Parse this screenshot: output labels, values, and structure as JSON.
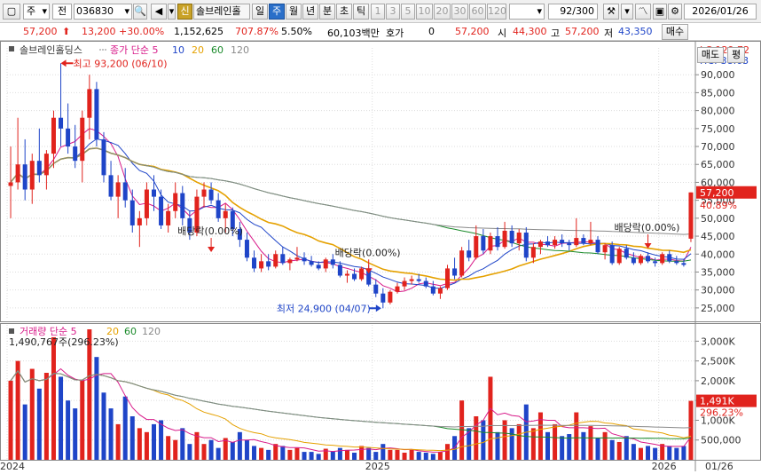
{
  "toolbar": {
    "period_select": "주",
    "market": "전",
    "code": "036830",
    "stock_name": "솔브레인홀",
    "tag": "신",
    "period_tabs": [
      "일",
      "주",
      "월",
      "년",
      "분",
      "초",
      "틱"
    ],
    "active_period": "주",
    "minute_buttons": [
      "1",
      "3",
      "5",
      "10",
      "20",
      "30",
      "60",
      "120"
    ],
    "count_value": "92",
    "count_total": "/300",
    "date": "2026/01/26"
  },
  "quote": {
    "price": "57,200",
    "change": "13,200",
    "change_pct": "+30.00%",
    "volume": "1,152,625",
    "volume_ratio": "707.87%",
    "turnover": "5.50%",
    "amount": "60,103백만",
    "hoga_label": "호가",
    "hoga_value": "0",
    "ask": "57,200",
    "open_label": "시",
    "open": "44,300",
    "high_label": "고",
    "high": "57,200",
    "low_label": "저",
    "low": "43,350",
    "buy_label": "매수",
    "sell_label": "매도",
    "eval_label": "평"
  },
  "chart_data": [
    {
      "type": "candlestick",
      "title": "솔브레인홀딩스",
      "legend": [
        "종가 단순 5",
        "10",
        "20",
        "60",
        "120"
      ],
      "legend_colors": [
        "#d81b8a",
        "#1f45c8",
        "#e5a100",
        "#1a8a2a",
        "#8a8a8a"
      ],
      "y_ticks": [
        "90,000",
        "85,000",
        "80,000",
        "75,000",
        "70,000",
        "65,000",
        "60,000",
        "55,000",
        "50,000",
        "45,000",
        "40,000",
        "35,000",
        "30,000",
        "25,000"
      ],
      "ylim": [
        22000,
        95000
      ],
      "x_labels": [
        "2024",
        "2025",
        "2026",
        "01/26"
      ],
      "lc": "LC:129.72",
      "hc": "HC:-38.63",
      "price_tag": "57,200",
      "pct_tag": "40.89%",
      "annotations": [
        {
          "text": "최고 93,200 (06/10)",
          "value": 93200
        },
        {
          "text": "최저 24,900 (04/07)",
          "value": 24900
        },
        {
          "text": "배당락(0.00%)",
          "value": 45000
        },
        {
          "text": "배당락(0.00%)",
          "value": 39000
        },
        {
          "text": "배당락(0.00%)",
          "value": 46000
        }
      ],
      "candles": [
        [
          59000,
          70000,
          50000,
          60000
        ],
        [
          60000,
          78000,
          58000,
          65000
        ],
        [
          65000,
          72000,
          55000,
          58000
        ],
        [
          58000,
          68000,
          54000,
          66000
        ],
        [
          66000,
          75000,
          60000,
          62000
        ],
        [
          62000,
          69000,
          58000,
          68000
        ],
        [
          68000,
          80000,
          64000,
          78000
        ],
        [
          78000,
          93200,
          70000,
          75000
        ],
        [
          75000,
          82000,
          68000,
          70000
        ],
        [
          70000,
          76000,
          64000,
          66000
        ],
        [
          66000,
          80000,
          60000,
          78000
        ],
        [
          78000,
          90000,
          72000,
          86000
        ],
        [
          86000,
          88000,
          70000,
          72000
        ],
        [
          72000,
          74000,
          60000,
          62000
        ],
        [
          62000,
          66000,
          55000,
          56000
        ],
        [
          56000,
          62000,
          50000,
          60000
        ],
        [
          60000,
          64000,
          53000,
          55000
        ],
        [
          55000,
          58000,
          46000,
          48000
        ],
        [
          48000,
          52000,
          42000,
          50000
        ],
        [
          50000,
          60000,
          48000,
          58000
        ],
        [
          58000,
          62000,
          52000,
          56000
        ],
        [
          56000,
          58000,
          47000,
          48000
        ],
        [
          48000,
          54000,
          46000,
          52000
        ],
        [
          52000,
          60000,
          50000,
          57000
        ],
        [
          57000,
          59000,
          48000,
          50000
        ],
        [
          50000,
          52000,
          44000,
          46000
        ],
        [
          46000,
          58000,
          45000,
          56000
        ],
        [
          56000,
          60000,
          53000,
          58000
        ],
        [
          58000,
          60000,
          54000,
          55000
        ],
        [
          55000,
          57000,
          49000,
          50000
        ],
        [
          50000,
          54000,
          46000,
          52000
        ],
        [
          52000,
          53000,
          45000,
          47000
        ],
        [
          47000,
          49000,
          42000,
          44000
        ],
        [
          44000,
          46000,
          38000,
          39000
        ],
        [
          39000,
          41000,
          35000,
          36000
        ],
        [
          36000,
          40000,
          35000,
          38000
        ],
        [
          38000,
          40000,
          35500,
          36500
        ],
        [
          36500,
          41000,
          36000,
          40000
        ],
        [
          40000,
          42000,
          37000,
          37500
        ],
        [
          37500,
          39000,
          35500,
          38500
        ],
        [
          38500,
          42000,
          38000,
          39000
        ],
        [
          39000,
          40500,
          37000,
          38000
        ],
        [
          38000,
          39500,
          36500,
          37000
        ],
        [
          37000,
          38000,
          35500,
          36000
        ],
        [
          36000,
          39000,
          35000,
          38500
        ],
        [
          38500,
          40000,
          36000,
          37000
        ],
        [
          37000,
          38000,
          33500,
          34000
        ],
        [
          34000,
          35500,
          32000,
          34500
        ],
        [
          34500,
          36000,
          32500,
          33000
        ],
        [
          33000,
          36500,
          32500,
          36000
        ],
        [
          36000,
          37000,
          31000,
          31500
        ],
        [
          31500,
          33000,
          28000,
          29000
        ],
        [
          29000,
          30500,
          24900,
          26500
        ],
        [
          26500,
          30000,
          26000,
          29500
        ],
        [
          29500,
          32000,
          29000,
          31000
        ],
        [
          31000,
          33500,
          30000,
          32500
        ],
        [
          32500,
          34000,
          31500,
          33000
        ],
        [
          33000,
          34500,
          32000,
          32500
        ],
        [
          32500,
          33500,
          30500,
          31000
        ],
        [
          31000,
          32500,
          28500,
          29000
        ],
        [
          29000,
          31000,
          27500,
          30500
        ],
        [
          30500,
          37000,
          30000,
          36000
        ],
        [
          36000,
          39000,
          33000,
          34000
        ],
        [
          34000,
          42000,
          33500,
          41000
        ],
        [
          41000,
          44000,
          38000,
          39000
        ],
        [
          39000,
          48000,
          38500,
          45000
        ],
        [
          45000,
          47000,
          40000,
          41000
        ],
        [
          41000,
          46000,
          40000,
          45000
        ],
        [
          45000,
          47500,
          41000,
          42000
        ],
        [
          42000,
          49000,
          41500,
          46500
        ],
        [
          46500,
          48000,
          42000,
          43000
        ],
        [
          43000,
          47000,
          41000,
          46000
        ],
        [
          46000,
          47500,
          38000,
          39000
        ],
        [
          39000,
          43000,
          37500,
          42000
        ],
        [
          42000,
          44000,
          40000,
          43500
        ],
        [
          43500,
          45000,
          42000,
          42500
        ],
        [
          42500,
          45000,
          41500,
          44000
        ],
        [
          44000,
          45500,
          42000,
          43000
        ],
        [
          43000,
          44000,
          41000,
          42500
        ],
        [
          42500,
          50000,
          42000,
          44500
        ],
        [
          44500,
          45500,
          42500,
          43000
        ],
        [
          43000,
          49000,
          42500,
          44000
        ],
        [
          44000,
          45000,
          40000,
          40500
        ],
        [
          40500,
          43000,
          38500,
          42500
        ],
        [
          42500,
          43500,
          37000,
          37500
        ],
        [
          37500,
          42000,
          37000,
          41500
        ],
        [
          41500,
          42500,
          38500,
          39000
        ],
        [
          39000,
          40500,
          37000,
          37500
        ],
        [
          37500,
          40000,
          37000,
          39500
        ],
        [
          39500,
          40500,
          37500,
          38000
        ],
        [
          38000,
          39000,
          36500,
          37500
        ],
        [
          37500,
          40500,
          37000,
          40000
        ],
        [
          40000,
          41000,
          37500,
          38000
        ],
        [
          38000,
          39500,
          37000,
          37500
        ],
        [
          37500,
          38500,
          36500,
          37000
        ],
        [
          44300,
          57200,
          43350,
          57200
        ]
      ]
    },
    {
      "type": "bar",
      "title": "거래량 단순",
      "legend": [
        "거래량 단순 5",
        "20",
        "60",
        "120"
      ],
      "legend_colors": [
        "#d81b8a",
        "#e5a100",
        "#1a8a2a",
        "#8a8a8a"
      ],
      "info": "1,490,767주(296.23%)",
      "y_ticks": [
        "3,000K",
        "2,500K",
        "2,000K",
        "1,500K",
        "1,000K",
        "500,000"
      ],
      "ylim": [
        0,
        3300000
      ],
      "volume_tag": "1,491K",
      "volume_pct_tag": "296.23%",
      "values": [
        2000000,
        2500000,
        1400000,
        2300000,
        1800000,
        2200000,
        3100000,
        2100000,
        1500000,
        1300000,
        2000000,
        3300000,
        2600000,
        1700000,
        1300000,
        900000,
        1600000,
        1100000,
        800000,
        700000,
        900000,
        1000000,
        600000,
        500000,
        800000,
        400000,
        700000,
        400000,
        500000,
        300000,
        550000,
        450000,
        700000,
        500000,
        350000,
        300000,
        250000,
        400000,
        350000,
        250000,
        300000,
        200000,
        200000,
        150000,
        280000,
        220000,
        300000,
        250000,
        180000,
        350000,
        300000,
        200000,
        400000,
        250000,
        250000,
        180000,
        250000,
        200000,
        180000,
        150000,
        200000,
        400000,
        600000,
        1500000,
        800000,
        1100000,
        1000000,
        2100000,
        700000,
        1000000,
        800000,
        900000,
        1400000,
        800000,
        1200000,
        700000,
        900000,
        600000,
        650000,
        1200000,
        700000,
        850000,
        550000,
        700000,
        500000,
        450000,
        600000,
        400000,
        300000,
        350000,
        300000,
        400000,
        350000,
        300000,
        350000,
        1490767
      ]
    }
  ]
}
